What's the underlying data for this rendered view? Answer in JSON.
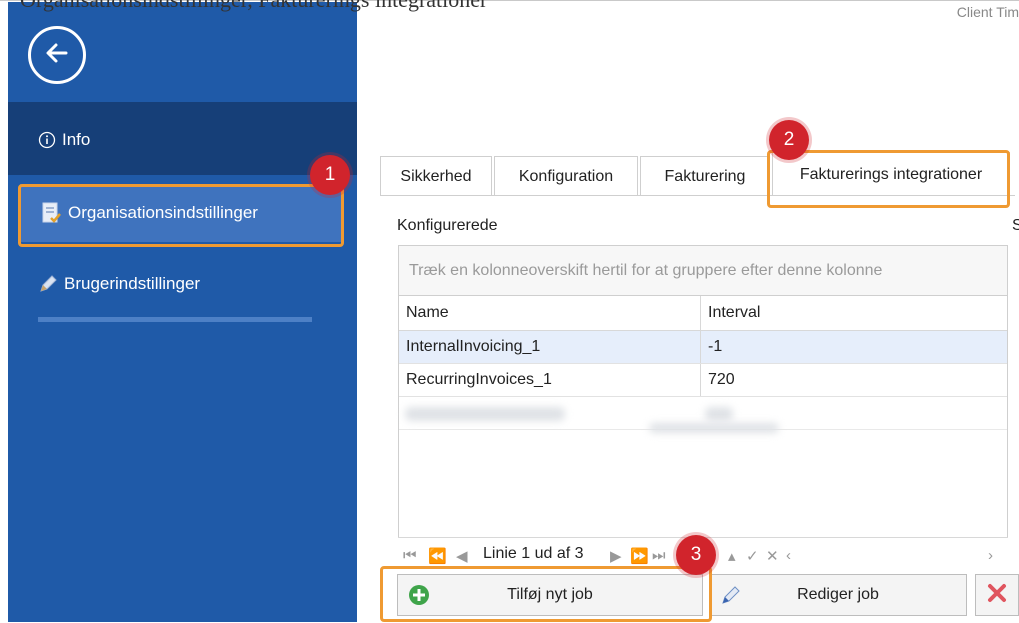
{
  "header": {
    "caption": "Organisationsindstillinger, Fakturerings integrationer",
    "client_time": "Client Tim"
  },
  "sidebar": {
    "back_icon": "arrow-left-circle-icon",
    "items": [
      {
        "label": "Info",
        "icon": "info-icon"
      },
      {
        "label": "Organisationsindstillinger",
        "icon": "org-settings-icon"
      },
      {
        "label": "Brugerindstillinger",
        "icon": "pencil-icon"
      }
    ]
  },
  "tabs": [
    {
      "label": "Sikkerhed"
    },
    {
      "label": "Konfiguration"
    },
    {
      "label": "Fakturering"
    },
    {
      "label": "Fakturerings integrationer"
    }
  ],
  "panel": {
    "title": "Konfigurerede",
    "right_label": "S",
    "group_hint": "Træk en kolonneoverskift hertil for at gruppere efter denne kolonne",
    "columns": [
      "Name",
      "Interval"
    ],
    "rows": [
      {
        "name": "InternalInvoicing_1",
        "interval": "-1"
      },
      {
        "name": "RecurringInvoices_1",
        "interval": "720"
      }
    ],
    "pager_text": "Linie 1 ud af 3"
  },
  "buttons": {
    "add_job": "Tilføj nyt job",
    "edit_job": "Rediger job"
  },
  "callouts": [
    "1",
    "2",
    "3"
  ],
  "colors": {
    "sidebar": "#1f5aa8",
    "sidebar_selected": "#3f73be",
    "highlight": "#ef9a32",
    "badge": "#d1242c"
  }
}
